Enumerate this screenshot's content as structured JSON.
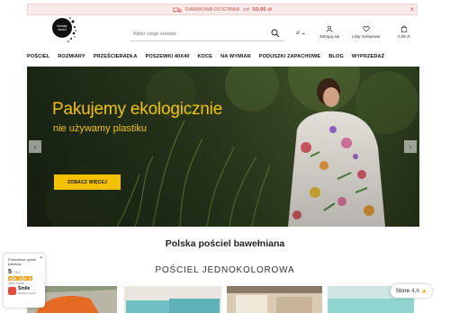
{
  "topbar": {
    "promo_prefix": "DARMOWA DOSTAWA",
    "promo_mid": "od",
    "promo_amount": "50,00 zł",
    "close_glyph": "×"
  },
  "logo": {
    "line1": "biomaly",
    "line2": "dream"
  },
  "search": {
    "placeholder": "Wpisz czego szukasz"
  },
  "header": {
    "currency": "zł",
    "login_label": "Zaloguj się",
    "wishlist_label": "Listy zakupowe",
    "cart_amount": "0,00 zł"
  },
  "nav": {
    "items": [
      "POŚCIEL",
      "ROZMIARY",
      "PRZEŚCIERADŁA",
      "POSZEWKI 40X40",
      "KOCE",
      "NA WYMIAR",
      "PODUSZKI ZAPACHOWE",
      "BLOG",
      "WYPRZEDAŻ"
    ]
  },
  "hero": {
    "headline": "Pakujemy ekologicznie",
    "subline": "nie używamy plastiku",
    "cta_label": "ZOBACZ WIĘCEJ",
    "prev_glyph": "‹",
    "next_glyph": "›"
  },
  "sections": {
    "title1": "Polska pościel bawełniana",
    "title2": "POŚCIEL JEDNOKOLOROWA"
  },
  "reviews": {
    "title": "Prawdziwe opinie klientów",
    "score": "5",
    "score_max": "/ 5.0",
    "count": "1641 opinii",
    "brand": "Smile",
    "brand_sub": "Zaufane Opinie",
    "close_glyph": "×"
  },
  "store_badge": {
    "name": "Store",
    "value": "4,6",
    "star": "★"
  },
  "colors": {
    "accent_yellow": "#f4c200",
    "promo_red": "#d9534f",
    "hero_dark": "#1d2a16"
  }
}
